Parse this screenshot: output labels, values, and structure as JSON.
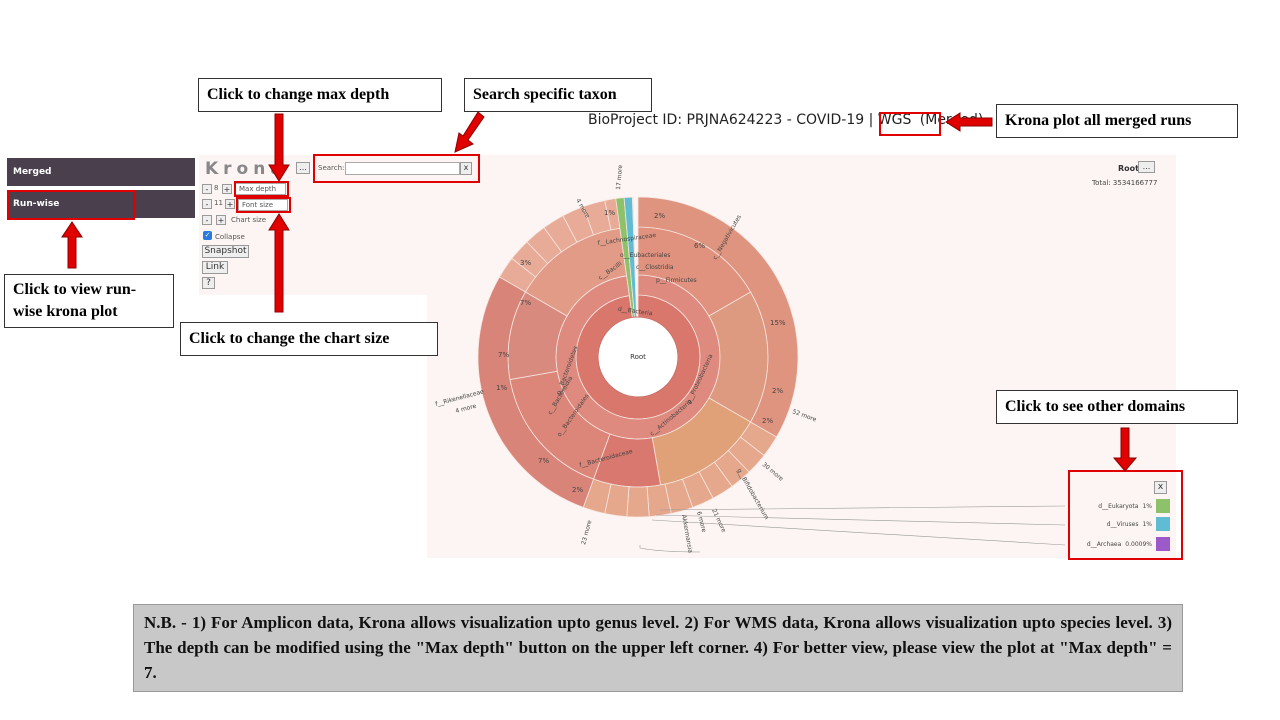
{
  "callouts": {
    "max_depth": "Click to change max depth",
    "search": "Search specific taxon",
    "merged": "Krona plot all merged runs",
    "runwise": "Click to view run-wise krona plot",
    "chart_size": "Click to change the chart size",
    "domains": "Click to see other domains"
  },
  "header": {
    "bioproject": "BioProject ID: PRJNA624223 - COVID-19 | WGS",
    "merged_tag": "(Merged)"
  },
  "sidebar": {
    "merged": "Merged",
    "runwise": "Run-wise"
  },
  "krona": {
    "logo": "Krona",
    "depth_value": "8",
    "depth_placeholder": "Max depth",
    "font_value": "11",
    "font_placeholder": "Font size",
    "chart_size": "Chart size",
    "collapse": "Collapse",
    "snapshot": "Snapshot",
    "link": "Link",
    "help": "?",
    "search_label": "Search:",
    "search_clear": "x",
    "root": "Root",
    "total": "Total: 3534166777",
    "minus": "-",
    "plus": "+",
    "dots": "...",
    "color_hex": {
      "ring_dark": "#d9776d",
      "ring_light": "#e9a690",
      "green": "#8dc26a",
      "blue": "#5fbcd3",
      "purple": "#9b59c9",
      "red": "#e00000"
    }
  },
  "legend": {
    "close": "x",
    "items": [
      {
        "label": "d__Eukaryota",
        "pct": "1%",
        "color": "#8dc26a"
      },
      {
        "label": "d__Viruses",
        "pct": "1%",
        "color": "#5fbcd3"
      },
      {
        "label": "d__Archaea",
        "pct": "0.0009%",
        "color": "#9b59c9"
      }
    ]
  },
  "plot_labels": {
    "bacteria": "d__Bacteria",
    "root": "Root",
    "firmicutes": "p__Firmicutes",
    "bacilli": "c__Bacilli",
    "clostridia": "c__Clostridia",
    "eubacteriales": "o__Eubacteriales",
    "lachnospiraceae": "f__Lachnospiraceae",
    "negativicutes": "c__Negativicutes",
    "bacteroidetes": "p__Bacteroidetes",
    "bacteroidia": "c__Bacteroidia",
    "bacteroidales": "o__Bacteroidales",
    "bacteroidaceae": "f__Bacteroidaceae",
    "rikenellaceae": "f__Rikenellaceae",
    "proteobacteria": "p__Proteobacteria",
    "actinobacteria": "c__Actinobacteria",
    "bifidobacterium": "g__Bifidobacterium",
    "akkermansia": "Akkermansia",
    "more_17": "17 more",
    "more_4a": "4 more",
    "more_4b": "4 more",
    "more_52": "52 more",
    "more_30": "30 more",
    "more_21": "21 more",
    "more_6": "6 more",
    "more_23": "23 more",
    "pct_15": "15%",
    "pct_7a": "7%",
    "pct_7b": "7%",
    "pct_7c": "7%",
    "pct_6": "6%",
    "pct_2a": "2%",
    "pct_2b": "2%",
    "pct_2c": "2%",
    "pct_1a": "1%",
    "pct_1b": "1%",
    "pct_3": "3%",
    "pct_2d": "2%"
  },
  "note": "N.B. - 1) For Amplicon data, Krona allows visualization upto genus level. 2) For WMS data, Krona allows visualization upto species level. 3) The depth can be modified using the \"Max depth\" button on the upper left corner. 4) For better view, please view the plot at \"Max depth\" = 7."
}
